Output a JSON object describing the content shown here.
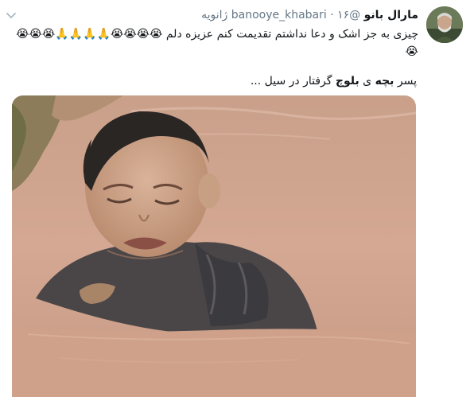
{
  "tweet": {
    "display_name": "مارال بانو",
    "handle": "@banooye_khabari",
    "separator": "·",
    "date": "۱۶ ژانویه",
    "text": "چیزی به جز اشک و دعا نداشتم تقدیمت کنم عزیزه دلم",
    "emojis": "😭😭😭😭🙏🙏🙏🙏😭😭😭😭",
    "caption": {
      "prefix": "پسر",
      "word_1": "بچه",
      "joiner": "ی",
      "word_2": "بلوچ",
      "suffix": "گرفتار در سیل ..."
    }
  },
  "icons": {
    "more": "chevron-down-icon",
    "avatar": "avatar-image",
    "media": "video-thumbnail"
  },
  "colors": {
    "text": "#14171a",
    "secondary": "#657786",
    "chevron": "#aab8c2",
    "flood_water": "#c89a82"
  }
}
